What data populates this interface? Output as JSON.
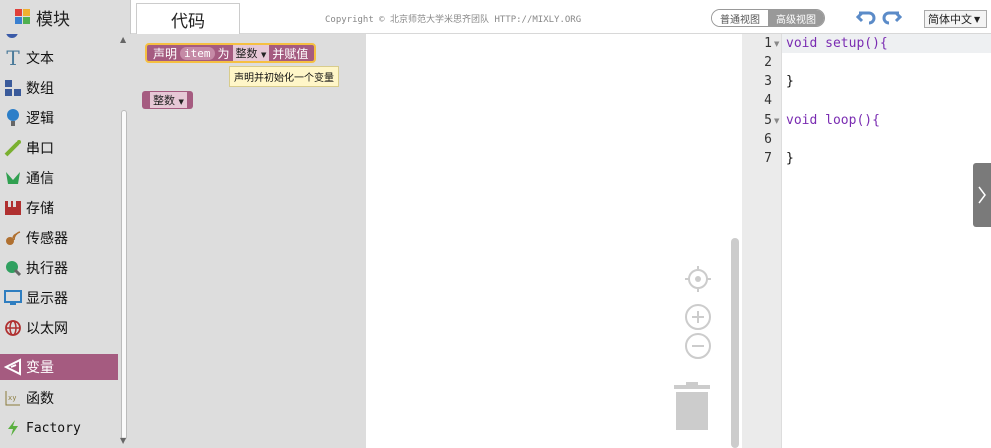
{
  "header": {
    "blocks_tab": "模块",
    "code_tab": "代码",
    "copyright": "Copyright © 北京师范大学米思齐团队 HTTP://MIXLY.ORG",
    "view_normal": "普通视图",
    "view_advanced": "高级视图",
    "language": "简体中文",
    "icons": [
      "puzzle-icon",
      "undo-icon",
      "redo-icon",
      "chevron-down-icon"
    ]
  },
  "toolbox": {
    "categories": [
      {
        "label": "文本",
        "icon": "text-icon",
        "color": "#4a7a9a"
      },
      {
        "label": "数组",
        "icon": "array-icon",
        "color": "#3a5a9a"
      },
      {
        "label": "逻辑",
        "icon": "logic-icon",
        "color": "#2c7ec8"
      },
      {
        "label": "串口",
        "icon": "serial-icon",
        "color": "#7ab030"
      },
      {
        "label": "通信",
        "icon": "communication-icon",
        "color": "#30a050"
      },
      {
        "label": "存储",
        "icon": "storage-icon",
        "color": "#b03030"
      },
      {
        "label": "传感器",
        "icon": "sensor-icon",
        "color": "#b07030"
      },
      {
        "label": "执行器",
        "icon": "actuator-icon",
        "color": "#30a060"
      },
      {
        "label": "显示器",
        "icon": "display-icon",
        "color": "#2f7ec0"
      },
      {
        "label": "以太网",
        "icon": "ethernet-icon",
        "color": "#b03030"
      },
      {
        "label": "变量",
        "icon": "variable-icon",
        "color": "#a55b80"
      },
      {
        "label": "函数",
        "icon": "function-icon",
        "color": "#8a7a3a"
      },
      {
        "label": "Factory",
        "icon": "factory-icon",
        "color": "#5ab040"
      }
    ],
    "selected": "变量"
  },
  "flyout": {
    "declare_block": {
      "prefix": "声明",
      "var_name": "item",
      "as": "为",
      "type": "整数",
      "suffix": "并赋值"
    },
    "tooltip": "声明并初始化一个变量",
    "int_block": {
      "type": "整数"
    }
  },
  "editor": {
    "lines": [
      {
        "num": "1",
        "code": "void setup(){"
      },
      {
        "num": "2",
        "code": ""
      },
      {
        "num": "3",
        "code": "}"
      },
      {
        "num": "4",
        "code": ""
      },
      {
        "num": "5",
        "code": "void loop(){"
      },
      {
        "num": "6",
        "code": ""
      },
      {
        "num": "7",
        "code": "}"
      }
    ]
  },
  "colors": {
    "variable_block": "#a55b80",
    "block_highlight": "#f5c042",
    "keyword": "#7a2cb2"
  }
}
